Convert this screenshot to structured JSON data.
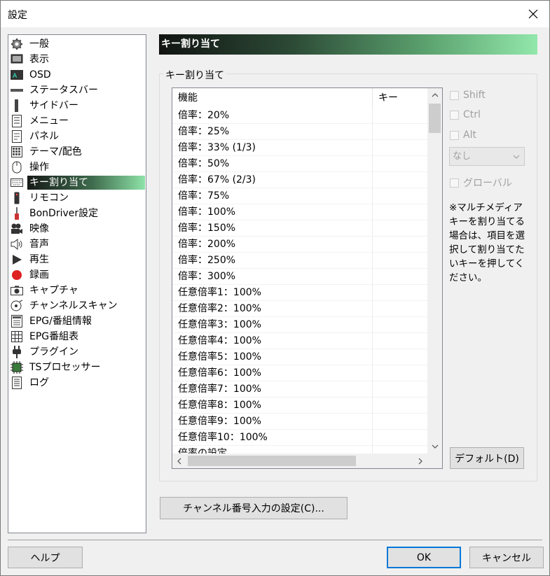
{
  "window": {
    "title": "設定"
  },
  "sidebar": {
    "items": [
      {
        "label": "一般",
        "icon": "gear-icon"
      },
      {
        "label": "表示",
        "icon": "monitor-icon"
      },
      {
        "label": "OSD",
        "icon": "osd-icon"
      },
      {
        "label": "ステータスバー",
        "icon": "statusbar-icon"
      },
      {
        "label": "サイドバー",
        "icon": "sidebar-icon"
      },
      {
        "label": "メニュー",
        "icon": "menu-icon"
      },
      {
        "label": "パネル",
        "icon": "panel-icon"
      },
      {
        "label": "テーマ/配色",
        "icon": "palette-icon"
      },
      {
        "label": "操作",
        "icon": "mouse-icon"
      },
      {
        "label": "キー割り当て",
        "icon": "keyboard-icon",
        "selected": true
      },
      {
        "label": "リモコン",
        "icon": "remote-icon"
      },
      {
        "label": "BonDriver設定",
        "icon": "driver-icon"
      },
      {
        "label": "映像",
        "icon": "camera-icon"
      },
      {
        "label": "音声",
        "icon": "speaker-icon"
      },
      {
        "label": "再生",
        "icon": "play-icon"
      },
      {
        "label": "録画",
        "icon": "record-icon"
      },
      {
        "label": "キャプチャ",
        "icon": "capture-icon"
      },
      {
        "label": "チャンネルスキャン",
        "icon": "scan-icon"
      },
      {
        "label": "EPG/番組情報",
        "icon": "epg-icon"
      },
      {
        "label": "EPG番組表",
        "icon": "program-guide-icon"
      },
      {
        "label": "プラグイン",
        "icon": "plug-icon"
      },
      {
        "label": "TSプロセッサー",
        "icon": "chip-icon"
      },
      {
        "label": "ログ",
        "icon": "log-icon"
      }
    ]
  },
  "page": {
    "header": "キー割り当て",
    "group_label": "キー割り当て",
    "columns": [
      "機能",
      "キー"
    ],
    "rows": [
      "倍率：20%",
      "倍率：25%",
      "倍率：33% (1/3)",
      "倍率：50%",
      "倍率：67% (2/3)",
      "倍率：75%",
      "倍率：100%",
      "倍率：150%",
      "倍率：200%",
      "倍率：250%",
      "倍率：300%",
      "任意倍率1：100%",
      "任意倍率2：100%",
      "任意倍率3：100%",
      "任意倍率4：100%",
      "任意倍率5：100%",
      "任意倍率6：100%",
      "任意倍率7：100%",
      "任意倍率8：100%",
      "任意倍率9：100%",
      "任意倍率10：100%",
      "倍率の設定..."
    ],
    "modifiers": {
      "shift": "Shift",
      "ctrl": "Ctrl",
      "alt": "Alt"
    },
    "key_select": "なし",
    "global_label": "グローバル",
    "note": "※マルチメディアキーを割り当てる場合は、項目を選択して割り当てたいキーを押してください。",
    "default_button": "デフォルト(D)",
    "channel_button": "チャンネル番号入力の設定(C)..."
  },
  "footer": {
    "help": "ヘルプ",
    "ok": "OK",
    "cancel": "キャンセル"
  }
}
